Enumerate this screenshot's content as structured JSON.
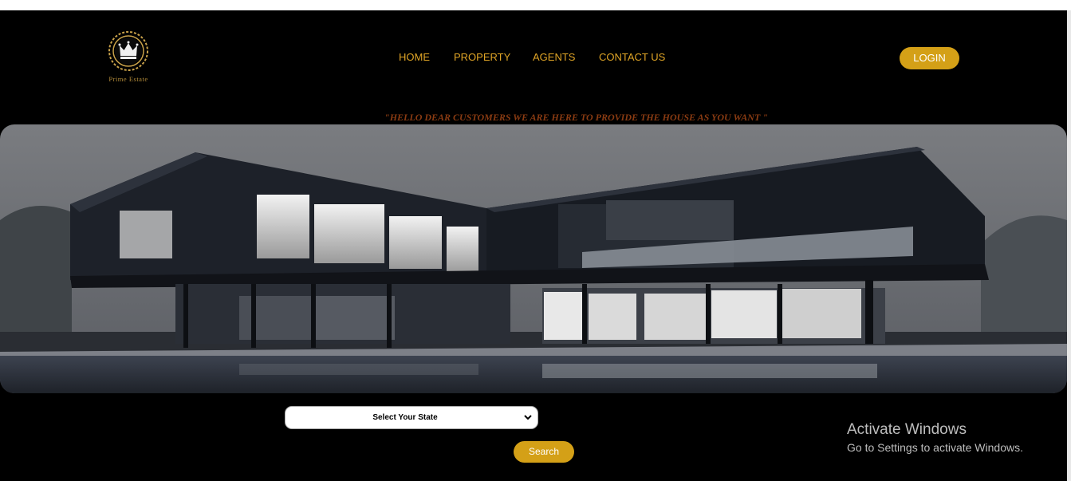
{
  "brand": {
    "name": "Prime Estate",
    "logo_icon": "crown-icon"
  },
  "nav": {
    "items": [
      "HOME",
      "PROPERTY",
      "AGENTS",
      "CONTACT US"
    ]
  },
  "header": {
    "login_label": "LOGIN"
  },
  "tagline": "\"HELLO DEAR CUSTOMERS WE ARE HERE TO PROVIDE THE HOUSE AS YOU WANT \"",
  "hero": {
    "image": "modern-house-photo"
  },
  "search": {
    "select_value": "Select Your State",
    "button_label": "Search"
  },
  "windows_watermark": {
    "title": "Activate Windows",
    "subtitle": "Go to Settings to activate Windows."
  },
  "colors": {
    "accent": "#d4a017",
    "nav_text": "#e0a526",
    "tagline": "#8a3b12",
    "background": "#000000"
  }
}
